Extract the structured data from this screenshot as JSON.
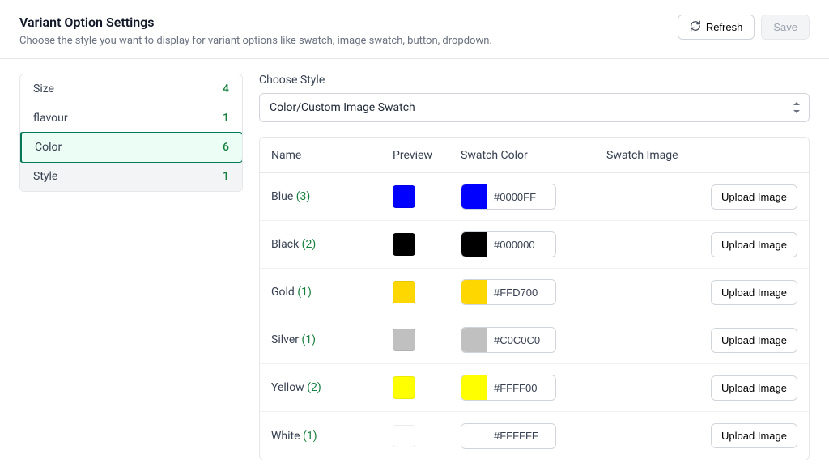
{
  "header": {
    "title": "Variant Option Settings",
    "subtitle": "Choose the style you want to display for variant options like swatch, image swatch, button, dropdown.",
    "refresh_label": "Refresh",
    "save_label": "Save"
  },
  "sidebar": {
    "items": [
      {
        "label": "Size",
        "count": "4",
        "state": ""
      },
      {
        "label": "flavour",
        "count": "1",
        "state": ""
      },
      {
        "label": "Color",
        "count": "6",
        "state": "active"
      },
      {
        "label": "Style",
        "count": "1",
        "state": "hovered"
      }
    ]
  },
  "main": {
    "choose_label": "Choose Style",
    "style_selected": "Color/Custom Image Swatch",
    "columns": {
      "name": "Name",
      "preview": "Preview",
      "swatch_color": "Swatch Color",
      "swatch_image": "Swatch Image"
    },
    "upload_label": "Upload Image",
    "rows": [
      {
        "name": "Blue",
        "count": "(3)",
        "hex": "#0000FF"
      },
      {
        "name": "Black",
        "count": "(2)",
        "hex": "#000000"
      },
      {
        "name": "Gold",
        "count": "(1)",
        "hex": "#FFD700"
      },
      {
        "name": "Silver",
        "count": "(1)",
        "hex": "#C0C0C0"
      },
      {
        "name": "Yellow",
        "count": "(2)",
        "hex": "#FFFF00"
      },
      {
        "name": "White",
        "count": "(1)",
        "hex": "#FFFFFF"
      }
    ]
  }
}
